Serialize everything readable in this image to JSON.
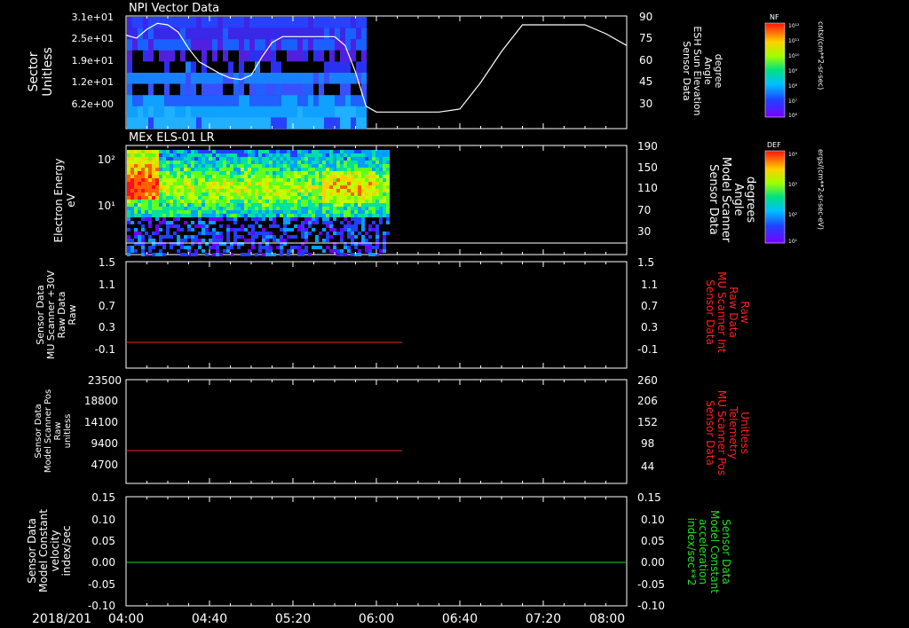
{
  "date_label": "2018/201",
  "time_ticks": [
    "04:00",
    "04:40",
    "05:20",
    "06:00",
    "06:40",
    "07:20",
    "08:00"
  ],
  "chart_data": [
    {
      "type": "heatmap",
      "title": "NPI Vector Data",
      "ylabel_left": [
        "Sector",
        "Unitless"
      ],
      "yticks_left": [
        "3.1e+01",
        "2.5e+01",
        "1.9e+01",
        "1.2e+01",
        "6.2e+00"
      ],
      "ylabel_right": [
        "Sensor Data",
        "ESH Sun Elevation",
        "Angle",
        "degree"
      ],
      "yticks_right": [
        "90",
        "75",
        "60",
        "45",
        "30"
      ],
      "data_extent_end": "05:55",
      "overlay_line": {
        "name": "ESH Sun Elevation Angle",
        "color": "#ffffff",
        "x": [
          "04:00",
          "04:05",
          "04:10",
          "04:15",
          "04:20",
          "04:25",
          "04:30",
          "04:35",
          "04:40",
          "04:45",
          "04:50",
          "04:55",
          "05:00",
          "05:05",
          "05:10",
          "05:15",
          "05:20",
          "05:25",
          "05:30",
          "05:35",
          "05:40",
          "05:45",
          "05:50",
          "05:55",
          "06:00",
          "06:10",
          "06:20",
          "06:30",
          "06:40",
          "06:50",
          "07:00",
          "07:10",
          "07:20",
          "07:30",
          "07:40",
          "07:50",
          "08:00"
        ],
        "y": [
          77,
          75,
          81,
          85,
          84,
          79,
          68,
          59,
          55,
          51,
          48,
          47,
          50,
          62,
          72,
          76,
          76,
          76,
          76,
          76,
          76,
          70,
          52,
          29,
          25,
          25,
          25,
          25,
          27,
          45,
          66,
          84,
          84,
          84,
          84,
          78,
          70
        ]
      },
      "colorbar": {
        "label": "NF",
        "units": "cnts/(cm**2-sr-sec)",
        "ticks": [
          "10¹²",
          "10¹¹",
          "10¹⁰",
          "10⁹",
          "10⁸",
          "10⁷",
          "10⁶"
        ]
      }
    },
    {
      "type": "heatmap",
      "title": "MEx ELS-01 LR",
      "ylabel_left": [
        "Electron Energy",
        "eV"
      ],
      "yticks_left": [
        "10²",
        "10¹"
      ],
      "ylabel_right": [
        "Sensor Data",
        "Model Scanner",
        "Angle",
        "degrees"
      ],
      "yticks_right": [
        "190",
        "150",
        "110",
        "70",
        "30"
      ],
      "data_extent_end": "06:05",
      "overlay_line": {
        "name": "Model Scanner Angle",
        "color": "#ffffff",
        "x": [
          "04:00",
          "08:00"
        ],
        "y": [
          10,
          10
        ]
      },
      "colorbar": {
        "label": "DEF",
        "units": "ergs/(cm**2-sr-sec-eV)",
        "ticks": [
          "10⁴",
          "10³",
          "10²",
          "10¹"
        ]
      }
    },
    {
      "type": "line",
      "ylabel_left": [
        "Sensor Data",
        "MU Scanner +30V",
        "Raw Data",
        "Raw"
      ],
      "yticks_left": [
        "1.5",
        "1.1",
        "0.7",
        "0.3",
        "-0.1"
      ],
      "ylim": [
        -0.3,
        1.5
      ],
      "ylabel_right": [
        "Sensor Data",
        "MU Scanner Int",
        "Raw Data",
        "Raw"
      ],
      "yticks_right": [
        "1.5",
        "1.1",
        "0.7",
        "0.3",
        "-0.1"
      ],
      "series": [
        {
          "color": "#ff2020",
          "x": [
            "04:00",
            "06:07"
          ],
          "y": [
            0.0,
            0.0
          ]
        }
      ]
    },
    {
      "type": "line",
      "ylabel_left": [
        "Sensor Data",
        "Model Scanner Pos",
        "Raw",
        "unitless"
      ],
      "yticks_left": [
        "23500",
        "18800",
        "14100",
        "9400",
        "4700"
      ],
      "ylim": [
        0,
        23500
      ],
      "ylabel_right": [
        "Sensor Data",
        "MU Scanner Pos",
        "Telemetry",
        "Unitless"
      ],
      "yticks_right": [
        "260",
        "206",
        "152",
        "98",
        "44"
      ],
      "series": [
        {
          "color": "#ff2020",
          "x": [
            "04:00",
            "06:07"
          ],
          "y": [
            7900,
            7900
          ]
        }
      ]
    },
    {
      "type": "line",
      "ylabel_left": [
        "Sensor Data",
        "Model Constant",
        "velocity",
        "index/sec"
      ],
      "yticks_left": [
        "0.15",
        "0.10",
        "0.05",
        "0.00",
        "-0.05",
        "-0.10"
      ],
      "ylim": [
        -0.1,
        0.15
      ],
      "ylabel_right": [
        "Sensor Data",
        "Model Constant",
        "acceleration",
        "index/sec**2"
      ],
      "yticks_right": [
        "0.15",
        "0.10",
        "0.05",
        "0.00",
        "-0.05",
        "-0.10"
      ],
      "series": [
        {
          "color": "#20d020",
          "x": [
            "04:00",
            "08:00"
          ],
          "y": [
            0.0,
            0.0
          ]
        }
      ]
    }
  ]
}
